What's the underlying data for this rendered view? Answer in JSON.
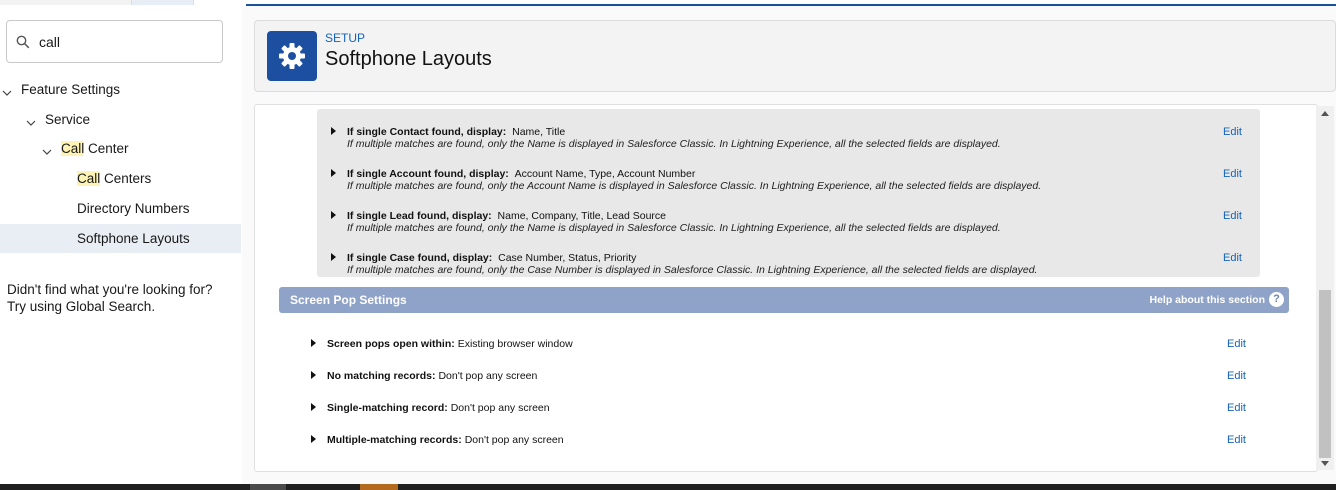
{
  "search": {
    "value": "call"
  },
  "tree": {
    "feature_settings": "Feature Settings",
    "service": "Service",
    "call_center_hl": "Call",
    "call_center_rest": " Center",
    "call_centers_hl": "Call",
    "call_centers_rest": " Centers",
    "directory_numbers": "Directory Numbers",
    "softphone_layouts": "Softphone Layouts"
  },
  "not_found": {
    "line1": "Didn't find what you're looking for?",
    "line2": "Try using Global Search."
  },
  "header": {
    "eyebrow": "SETUP",
    "title": "Softphone Layouts"
  },
  "display_rows": [
    {
      "label": "If single Contact found, display:",
      "value": "Name, Title",
      "note": "If multiple matches are found, only the Name is displayed in Salesforce Classic. In Lightning Experience, all the selected fields are displayed.",
      "edit": "Edit"
    },
    {
      "label": "If single Account found, display:",
      "value": "Account Name, Type, Account Number",
      "note": "If multiple matches are found, only the Account Name is displayed in Salesforce Classic. In Lightning Experience, all the selected fields are displayed.",
      "edit": "Edit"
    },
    {
      "label": "If single Lead found, display:",
      "value": "Name, Company, Title, Lead Source",
      "note": "If multiple matches are found, only the Name is displayed in Salesforce Classic. In Lightning Experience, all the selected fields are displayed.",
      "edit": "Edit"
    },
    {
      "label": "If single Case found, display:",
      "value": "Case Number, Status, Priority",
      "note": "If multiple matches are found, only the Case Number is displayed in Salesforce Classic. In Lightning Experience, all the selected fields are displayed.",
      "edit": "Edit"
    }
  ],
  "screen_pop": {
    "title": "Screen Pop Settings",
    "help": "Help about this section",
    "help_icon": "?",
    "rows": [
      {
        "label": "Screen pops open within:",
        "value": "Existing browser window",
        "edit": "Edit"
      },
      {
        "label": "No matching records:",
        "value": "Don't pop any screen",
        "edit": "Edit"
      },
      {
        "label": "Single-matching record:",
        "value": "Don't pop any screen",
        "edit": "Edit"
      },
      {
        "label": "Multiple-matching records:",
        "value": "Don't pop any screen",
        "edit": "Edit"
      }
    ]
  },
  "colors": {
    "accent": "#1c4f9f",
    "link": "#1563b7",
    "section_bar": "#8fa3c8",
    "highlight": "#fdf3b5"
  }
}
